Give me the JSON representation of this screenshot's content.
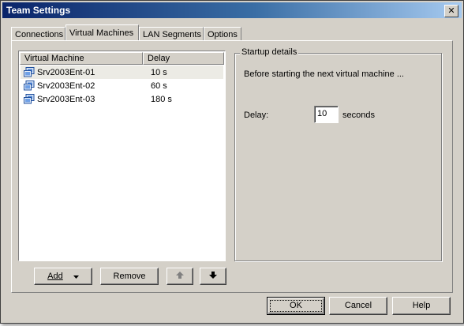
{
  "window": {
    "title": "Team Settings",
    "close_glyph": "✕"
  },
  "tabs": [
    {
      "label": "Connections",
      "active": false
    },
    {
      "label": "Virtual Machines",
      "active": true
    },
    {
      "label": "LAN Segments",
      "active": false
    },
    {
      "label": "Options",
      "active": false
    }
  ],
  "vm_list": {
    "columns": [
      "Virtual Machine",
      "Delay"
    ],
    "rows": [
      {
        "name": "Srv2003Ent-01",
        "delay": "10 s",
        "selected": true,
        "icon": "virtual-machine-icon"
      },
      {
        "name": "Srv2003Ent-02",
        "delay": "60 s",
        "selected": false,
        "icon": "virtual-machine-icon"
      },
      {
        "name": "Srv2003Ent-03",
        "delay": "180 s",
        "selected": false,
        "icon": "virtual-machine-icon"
      }
    ]
  },
  "list_buttons": {
    "add_label": "Add",
    "add_icon": "dropdown-triangle-icon",
    "remove_label": "Remove",
    "move_up_icon": "arrow-up-icon",
    "move_down_icon": "arrow-down-icon"
  },
  "startup": {
    "group_title": "Startup details",
    "description": "Before starting the next virtual machine ...",
    "delay_label": "Delay:",
    "delay_value": "10",
    "unit_label": "seconds"
  },
  "dialog_buttons": {
    "ok_label": "OK",
    "cancel_label": "Cancel",
    "help_label": "Help"
  },
  "colors": {
    "dialog_face": "#d4d0c8",
    "title_gradient_start": "#0a246a",
    "title_gradient_end": "#a6caf0",
    "selected_row": "#ecebe5"
  }
}
